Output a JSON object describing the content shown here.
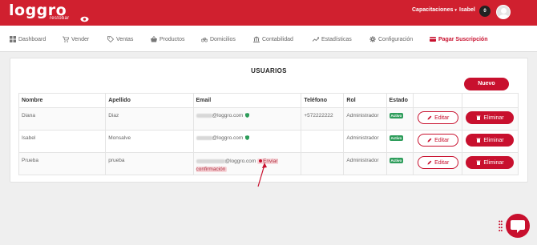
{
  "brand": {
    "logo_text": "loggro",
    "logo_sub": "restobar"
  },
  "topbar": {
    "capacitaciones": "Capacitaciones",
    "user_name": "Isabel",
    "notifications": "0"
  },
  "nav": {
    "items": [
      {
        "label": "Dashboard",
        "icon": "grid-icon"
      },
      {
        "label": "Vender",
        "icon": "cart-icon"
      },
      {
        "label": "Ventas",
        "icon": "tag-icon"
      },
      {
        "label": "Productos",
        "icon": "basket-icon"
      },
      {
        "label": "Domicilios",
        "icon": "bike-icon"
      },
      {
        "label": "Contabilidad",
        "icon": "bank-icon"
      },
      {
        "label": "Estadísticas",
        "icon": "trend-icon"
      },
      {
        "label": "Configuración",
        "icon": "gear-icon"
      },
      {
        "label": "Pagar Suscripción",
        "icon": "card-icon"
      }
    ]
  },
  "users": {
    "title": "USUARIOS",
    "new_button": "Nuevo",
    "columns": [
      "Nombre",
      "Apellido",
      "Email",
      "Teléfono",
      "Rol",
      "Estado"
    ],
    "edit_label": "Editar",
    "delete_label": "Eliminar",
    "rows": [
      {
        "nombre": "Diana",
        "apellido": "Diaz",
        "email_domain": "@loggro.com",
        "telefono": "+572222222",
        "rol": "Administrador",
        "estado": "Activo"
      },
      {
        "nombre": "Isabel",
        "apellido": "Monsalve",
        "email_domain": "@loggro.com",
        "telefono": "",
        "rol": "Administrador",
        "estado": "Activo"
      },
      {
        "nombre": "Prueba",
        "apellido": "prueba",
        "email_domain": "@loggro.com",
        "telefono": "",
        "rol": "Administrador",
        "estado": "Activo",
        "send_confirmation": "Enviar confirmación"
      }
    ]
  },
  "colors": {
    "brand_red": "#c8102e",
    "topbar_red": "#d0202f",
    "active_green": "#2e9d5b"
  }
}
